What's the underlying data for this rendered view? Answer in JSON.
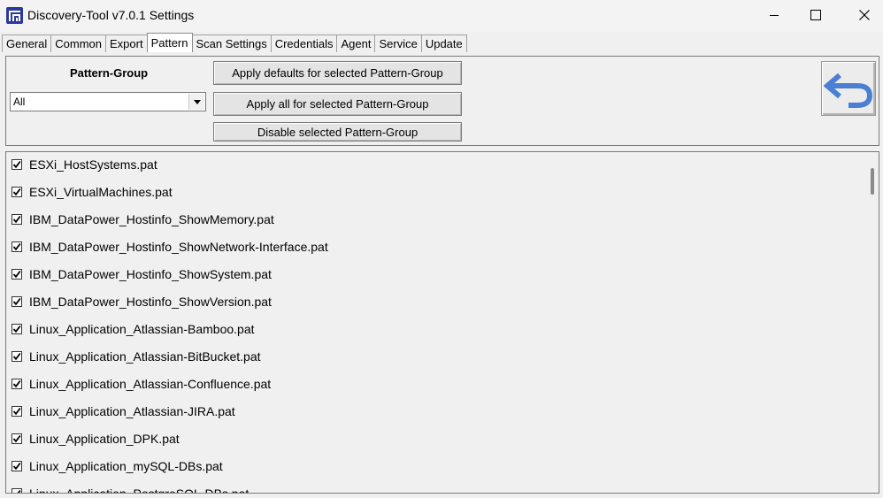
{
  "window": {
    "title": "Discovery-Tool v7.0.1 Settings"
  },
  "tabs": [
    {
      "label": "General",
      "active": false
    },
    {
      "label": "Common",
      "active": false
    },
    {
      "label": "Export",
      "active": false
    },
    {
      "label": "Pattern",
      "active": true
    },
    {
      "label": "Scan Settings",
      "active": false
    },
    {
      "label": "Credentials",
      "active": false
    },
    {
      "label": "Agent",
      "active": false
    },
    {
      "label": "Service",
      "active": false
    },
    {
      "label": "Update",
      "active": false
    }
  ],
  "pattern_group": {
    "label": "Pattern-Group",
    "selected": "All",
    "apply_defaults_label": "Apply defaults for selected Pattern-Group",
    "apply_all_label": "Apply all for selected Pattern-Group",
    "disable_label": "Disable selected Pattern-Group"
  },
  "patterns": [
    {
      "name": "ESXi_HostSystems.pat",
      "checked": true
    },
    {
      "name": "ESXi_VirtualMachines.pat",
      "checked": true
    },
    {
      "name": "IBM_DataPower_Hostinfo_ShowMemory.pat",
      "checked": true
    },
    {
      "name": "IBM_DataPower_Hostinfo_ShowNetwork-Interface.pat",
      "checked": true
    },
    {
      "name": "IBM_DataPower_Hostinfo_ShowSystem.pat",
      "checked": true
    },
    {
      "name": "IBM_DataPower_Hostinfo_ShowVersion.pat",
      "checked": true
    },
    {
      "name": "Linux_Application_Atlassian-Bamboo.pat",
      "checked": true
    },
    {
      "name": "Linux_Application_Atlassian-BitBucket.pat",
      "checked": true
    },
    {
      "name": "Linux_Application_Atlassian-Confluence.pat",
      "checked": true
    },
    {
      "name": "Linux_Application_Atlassian-JIRA.pat",
      "checked": true
    },
    {
      "name": "Linux_Application_DPK.pat",
      "checked": true
    },
    {
      "name": "Linux_Application_mySQL-DBs.pat",
      "checked": true
    },
    {
      "name": "Linux_Application_PostgreSQL-DBs.pat",
      "checked": true
    }
  ],
  "colors": {
    "accent": "#2b3a9a",
    "undo_arrow": "#4a7fd4"
  }
}
